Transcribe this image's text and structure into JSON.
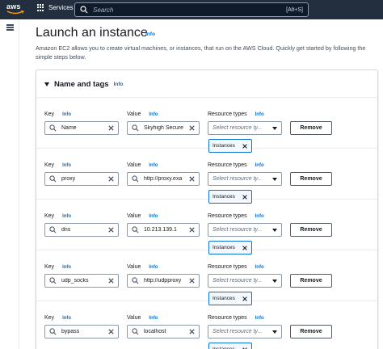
{
  "topnav": {
    "logo_text": "aws",
    "services_label": "Services",
    "search_placeholder": "Search",
    "search_shortcut": "[Alt+S]"
  },
  "page": {
    "title": "Launch an instance",
    "title_info": "Info",
    "description": "Amazon EC2 allows you to create virtual machines, or instances, that run on the AWS Cloud. Quickly get started by following the simple steps below."
  },
  "panel": {
    "title": "Name and tags",
    "info": "Info",
    "labels": {
      "key": "Key",
      "value": "Value",
      "resource_types": "Resource types",
      "info": "Info"
    },
    "select_placeholder": "Select resource ty...",
    "remove_label": "Remove",
    "tags": [
      {
        "key": "Name",
        "value": "Skyhigh Secure",
        "token": "Instances"
      },
      {
        "key": "proxy",
        "value": "http://proxy.exa",
        "token": "Instances"
      },
      {
        "key": "dns",
        "value": "10.213.139.1",
        "token": "Instances"
      },
      {
        "key": "udp_socks",
        "value": "http://udpproxy",
        "token": "Instances"
      },
      {
        "key": "bypass",
        "value": "localhost",
        "token": "Instances"
      }
    ]
  },
  "colors": {
    "nav_bg": "#232f3e",
    "link": "#0972d3",
    "aws_orange": "#ff9900"
  }
}
